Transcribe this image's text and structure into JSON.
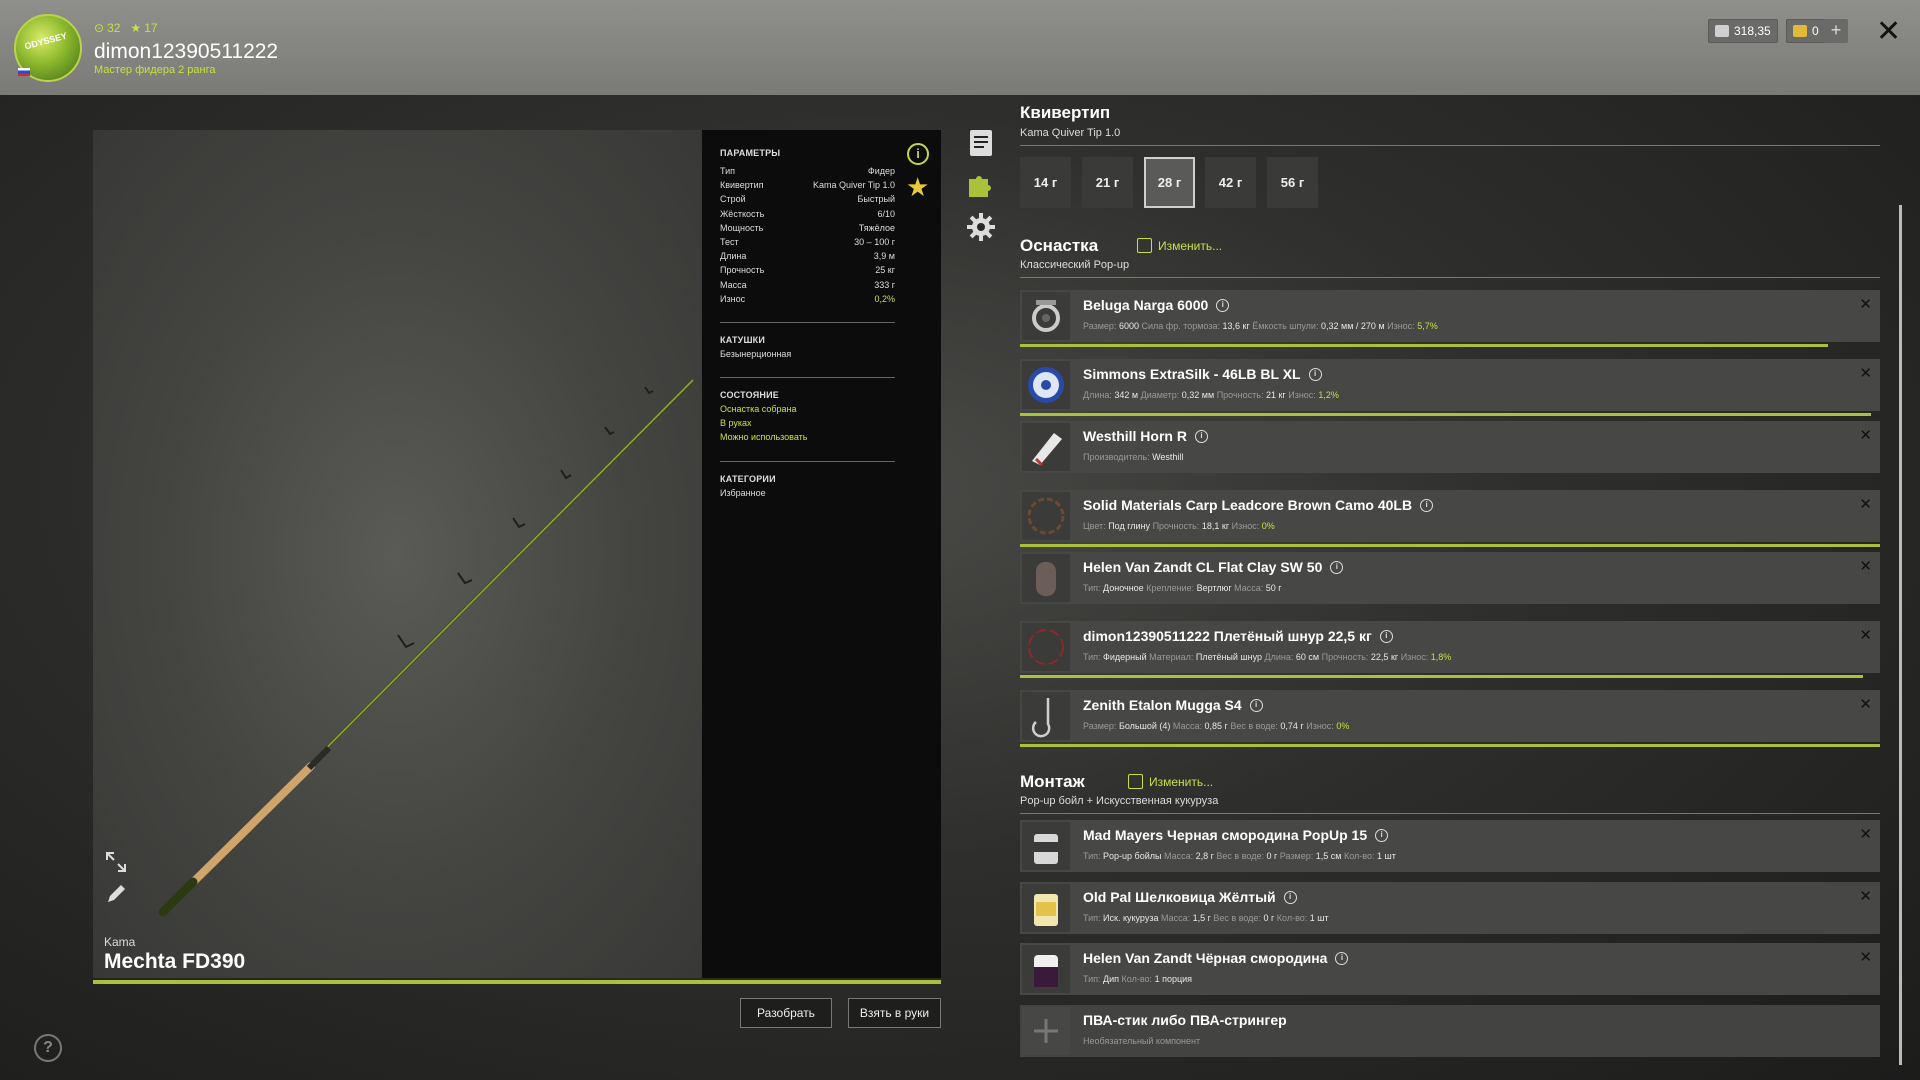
{
  "player": {
    "coins": "32",
    "stars": "17",
    "username": "dimon12390511222",
    "rank": "Мастер фидера 2 ранга",
    "logo_text": "ODYSSEY"
  },
  "currency": {
    "silver": "318,35",
    "gold": "0",
    "plus": "+"
  },
  "close": "✕",
  "rod": {
    "brand": "Kama",
    "name": "Mechta FD390"
  },
  "params": {
    "title": "ПАРАМЕТРЫ",
    "rows": [
      {
        "k": "Тип",
        "v": "Фидер"
      },
      {
        "k": "Квивертип",
        "v": "Kama Quiver Tip 1.0"
      },
      {
        "k": "Строй",
        "v": "Быстрый"
      },
      {
        "k": "Жёсткость",
        "v": "6/10"
      },
      {
        "k": "Мощность",
        "v": "Тяжёлое"
      },
      {
        "k": "Тест",
        "v": "30 – 100 г"
      },
      {
        "k": "Длина",
        "v": "3,9 м"
      },
      {
        "k": "Прочность",
        "v": "25 кг"
      },
      {
        "k": "Масса",
        "v": "333 г"
      },
      {
        "k": "Износ",
        "v": "0,2%"
      }
    ],
    "reels_title": "КАТУШКИ",
    "reels_value": "Безынерционная",
    "state_title": "СОСТОЯНИЕ",
    "state_lines": [
      "Оснастка собрана",
      "В руках",
      "Можно использовать"
    ],
    "cat_title": "КАТЕГОРИИ",
    "cat_value": "Избранное"
  },
  "quiver": {
    "title": "Квивертип",
    "subtitle": "Kama Quiver Tip 1.0",
    "weights": [
      "14 г",
      "21 г",
      "28 г",
      "42 г",
      "56 г"
    ],
    "active_index": 2
  },
  "tackle": {
    "title": "Оснастка",
    "change": "Изменить...",
    "subtitle": "Классический Pop-up",
    "items": [
      {
        "name": "Beluga Narga 6000",
        "desc": [
          [
            "Размер:",
            "6000"
          ],
          [
            "Сила фр. тормоза:",
            "13,6 кг"
          ],
          [
            "Ёмкость шпули:",
            "0,32 мм / 270 м"
          ],
          [
            "Износ:",
            "5,7%",
            "g"
          ]
        ],
        "bar": 0.94
      },
      {
        "name": "Simmons ExtraSilk - 46LB BL XL",
        "desc": [
          [
            "Длина:",
            "342 м"
          ],
          [
            "Диаметр:",
            "0,32 мм"
          ],
          [
            "Прочность:",
            "21 кг"
          ],
          [
            "Износ:",
            "1,2%",
            "g"
          ]
        ],
        "bar": 0.99
      },
      {
        "name": "Westhill Horn R",
        "desc": [
          [
            "Производитель:",
            "Westhill"
          ]
        ],
        "bar": 0
      },
      {
        "name": "Solid Materials Carp Leadcore Brown Camo 40LB",
        "desc": [
          [
            "Цвет:",
            "Под глину"
          ],
          [
            "Прочность:",
            "18,1 кг"
          ],
          [
            "Износ:",
            "0%",
            "g"
          ]
        ],
        "bar": 1.0
      },
      {
        "name": "Helen Van Zandt CL Flat Clay SW 50",
        "desc": [
          [
            "Тип:",
            "Доночное"
          ],
          [
            "Крепление:",
            "Вертлюг"
          ],
          [
            "Масса:",
            "50 г"
          ]
        ],
        "bar": 0
      },
      {
        "name": "dimon12390511222 Плетёный шнур 22,5 кг",
        "desc": [
          [
            "Тип:",
            "Фидерный"
          ],
          [
            "Материал:",
            "Плетёный шнур"
          ],
          [
            "Длина:",
            "60 см"
          ],
          [
            "Прочность:",
            "22,5 кг"
          ],
          [
            "Износ:",
            "1,8%",
            "g"
          ]
        ],
        "bar": 0.98
      },
      {
        "name": "Zenith Etalon Mugga S4",
        "desc": [
          [
            "Размер:",
            "Большой (4)"
          ],
          [
            "Масса:",
            "0,85 г"
          ],
          [
            "Вес в воде:",
            "0,74 г"
          ],
          [
            "Износ:",
            "0%",
            "g"
          ]
        ],
        "bar": 1.0
      }
    ]
  },
  "rig": {
    "title": "Монтаж",
    "change": "Изменить...",
    "subtitle": "Pop-up бойл + Искусственная кукуруза",
    "items": [
      {
        "name": "Mad Mayers Черная смородина PopUp 15",
        "desc": [
          [
            "Тип:",
            "Pop-up бойлы"
          ],
          [
            "Масса:",
            "2,8 г"
          ],
          [
            "Вес в воде:",
            "0 г"
          ],
          [
            "Размер:",
            "1,5 см"
          ],
          [
            "Кол-во:",
            "1 шт"
          ]
        ]
      },
      {
        "name": "Old Pal Шелковица Жёлтый",
        "desc": [
          [
            "Тип:",
            "Иск. кукуруза"
          ],
          [
            "Масса:",
            "1,5 г"
          ],
          [
            "Вес в воде:",
            "0 г"
          ],
          [
            "Кол-во:",
            "1 шт"
          ]
        ]
      },
      {
        "name": "Helen Van Zandt Чёрная смородина",
        "desc": [
          [
            "Тип:",
            "Дип"
          ],
          [
            "Кол-во:",
            "1 порция"
          ]
        ]
      },
      {
        "name": "ПВА-стик либо ПВА-стрингер",
        "desc": [
          [
            "Необязательный компонент",
            ""
          ]
        ],
        "optional": true
      }
    ]
  },
  "buttons": {
    "disassemble": "Разобрать",
    "take": "Взять в руки"
  },
  "help": "?"
}
